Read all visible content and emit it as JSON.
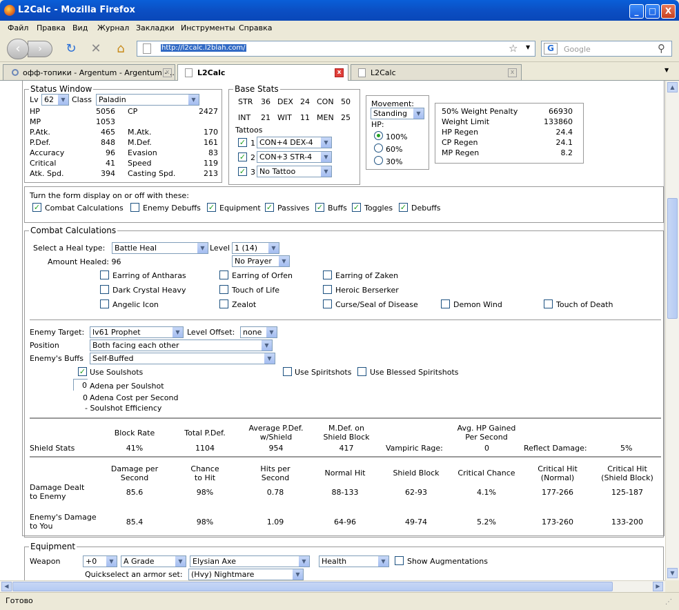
{
  "window": {
    "title": "L2Calc - Mozilla Firefox",
    "min": "_",
    "max": "□",
    "close": "X"
  },
  "menu": [
    "Файл",
    "Правка",
    "Вид",
    "Журнал",
    "Закладки",
    "Инструменты",
    "Справка"
  ],
  "nav": {
    "url": "http://l2calc.l2blah.com/",
    "search_placeholder": "Google"
  },
  "tabs": [
    {
      "label": "офф-топики - Argentum - Argentum - ..."
    },
    {
      "label": "L2Calc"
    },
    {
      "label": "L2Calc"
    }
  ],
  "status_window": {
    "legend": "Status Window",
    "lv_label": "Lv",
    "lv": "62",
    "class_label": "Class",
    "class": "Paladin",
    "left": [
      [
        "HP",
        "5056"
      ],
      [
        "MP",
        "1053"
      ],
      [
        "P.Atk.",
        "465"
      ],
      [
        "P.Def.",
        "848"
      ],
      [
        "Accuracy",
        "96"
      ],
      [
        "Critical",
        "41"
      ],
      [
        "Atk. Spd.",
        "394"
      ]
    ],
    "right": [
      [
        "CP",
        "2427"
      ],
      [
        "",
        ""
      ],
      [
        "M.Atk.",
        "170"
      ],
      [
        "M.Def.",
        "161"
      ],
      [
        "Evasion",
        "83"
      ],
      [
        "Speed",
        "119"
      ],
      [
        "Casting Spd.",
        "213"
      ]
    ]
  },
  "base_stats": {
    "legend": "Base Stats",
    "row1": [
      "STR",
      "36",
      "DEX",
      "24",
      "CON",
      "50"
    ],
    "row2": [
      "INT",
      "21",
      "WIT",
      "11",
      "MEN",
      "25"
    ],
    "tattoos_label": "Tattoos",
    "tattoos": [
      {
        "n": "1",
        "v": "CON+4 DEX-4"
      },
      {
        "n": "2",
        "v": "CON+3 STR-4"
      },
      {
        "n": "3",
        "v": "No Tattoo"
      }
    ]
  },
  "movement": {
    "label": "Movement:",
    "value": "Standing",
    "hp_label": "HP:",
    "hp_opts": [
      "100%",
      "60%",
      "30%"
    ]
  },
  "weight": [
    [
      "50% Weight Penalty",
      "66930"
    ],
    [
      "Weight Limit",
      "133860"
    ],
    [
      "HP Regen",
      "24.4"
    ],
    [
      "CP Regen",
      "24.1"
    ],
    [
      "MP Regen",
      "8.2"
    ]
  ],
  "toggles": {
    "text": "Turn the form display on or off with these:",
    "items": [
      {
        "l": "Combat Calculations",
        "on": true
      },
      {
        "l": "Enemy Debuffs",
        "on": false
      },
      {
        "l": "Equipment",
        "on": true
      },
      {
        "l": "Passives",
        "on": true
      },
      {
        "l": "Buffs",
        "on": true
      },
      {
        "l": "Toggles",
        "on": true
      },
      {
        "l": "Debuffs",
        "on": true
      }
    ]
  },
  "combat": {
    "legend": "Combat Calculations",
    "heal_label": "Select a Heal type:",
    "heal": "Battle Heal",
    "level_label": "Level",
    "level": "1 (14)",
    "amount_label": "Amount Healed: 96",
    "prayer": "No Prayer",
    "items": [
      "Earring of Antharas",
      "Earring of Orfen",
      "Earring of Zaken",
      "Dark Crystal Heavy",
      "Touch of Life",
      "Heroic Berserker",
      "Angelic Icon",
      "Zealot",
      "Curse/Seal of Disease",
      "Demon Wind",
      "Touch of Death"
    ],
    "enemy_target_label": "Enemy Target:",
    "enemy_target": "lv61 Prophet",
    "offset_label": "Level Offset:",
    "offset": "none",
    "position_label": "Position",
    "position": "Both facing each other",
    "buffs_label": "Enemy's Buffs",
    "buffs": "Self-Buffed",
    "soulshots": "Use Soulshots",
    "spiritshots": "Use Spiritshots",
    "blessed": "Use Blessed Spiritshots",
    "adena_ss_val": "0",
    "adena_ss": "Adena per Soulshot",
    "adena_cost_val": "0",
    "adena_cost": "Adena Cost per Second",
    "efficiency": "- Soulshot Efficiency",
    "shield_headers": [
      "Block Rate",
      "Total P.Def.",
      "Average P.Def.\nw/Shield",
      "M.Def. on\nShield Block",
      "Avg. HP Gained\nPer Second"
    ],
    "shield_label": "Shield Stats",
    "shield_vals": [
      "41%",
      "1104",
      "954",
      "417"
    ],
    "vampiric_label": "Vampiric Rage:",
    "vampiric": "0",
    "reflect_label": "Reflect Damage:",
    "reflect": "5%",
    "dmg_headers": [
      "Damage per\nSecond",
      "Chance\nto Hit",
      "Hits per\nSecond",
      "Normal Hit",
      "Shield Block",
      "Critical Chance",
      "Critical Hit\n(Normal)",
      "Critical Hit\n(Shield Block)"
    ],
    "dmg_rows": [
      {
        "label": "Damage Dealt\nto Enemy",
        "vals": [
          "85.6",
          "98%",
          "0.78",
          "88-133",
          "62-93",
          "4.1%",
          "177-266",
          "125-187"
        ]
      },
      {
        "label": "Enemy's Damage\nto You",
        "vals": [
          "85.4",
          "98%",
          "1.09",
          "64-96",
          "49-74",
          "5.2%",
          "173-260",
          "133-200"
        ]
      }
    ]
  },
  "equipment": {
    "legend": "Equipment",
    "weapon_label": "Weapon",
    "enchant": "+0",
    "grade": "A Grade",
    "weapon": "Elysian Axe",
    "aug": "Health",
    "show_aug": "Show Augmentations",
    "armor_label": "Quickselect an armor set:",
    "armor": "(Hvy) Nightmare"
  },
  "status": "Готово"
}
